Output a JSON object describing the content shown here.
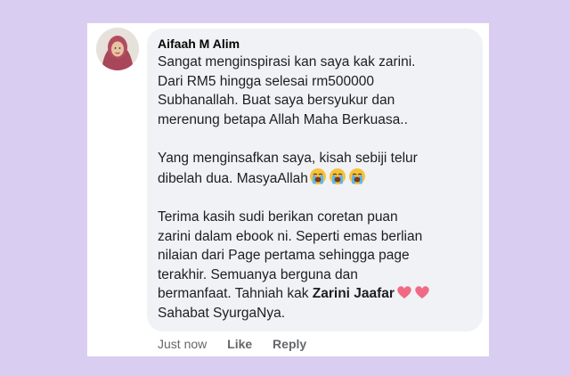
{
  "comment": {
    "author": "Aifaah M Alim",
    "lines_p1": [
      "Sangat menginspirasi kan saya kak zarini.",
      "Dari RM5 hingga selesai rm500000",
      "Subhanallah. Buat saya bersyukur dan",
      "merenung betapa Allah Maha Berkuasa.."
    ],
    "lines_p2": [
      "Yang menginsafkan saya, kisah sebiji telur",
      "dibelah dua. MasyaAllah"
    ],
    "lines_p3": [
      "Terima kasih sudi berikan coretan puan",
      "zarini dalam ebook ni. Seperti emas berlian",
      "nilaian dari Page pertama sehingga page",
      "terakhir. Semuanya berguna dan",
      "bermanfaat. Tahniah kak ",
      "Zarini Jaafar",
      "Sahabat SyurgaNya."
    ],
    "emoji_p2": "loudly-crying-face-icon",
    "emoji_p3": "heart-icon"
  },
  "actions": {
    "time": "Just now",
    "like": "Like",
    "reply": "Reply"
  },
  "colors": {
    "page_bg": "#d9cef1",
    "bubble_bg": "#f0f2f5",
    "meta_text": "#65676b"
  }
}
